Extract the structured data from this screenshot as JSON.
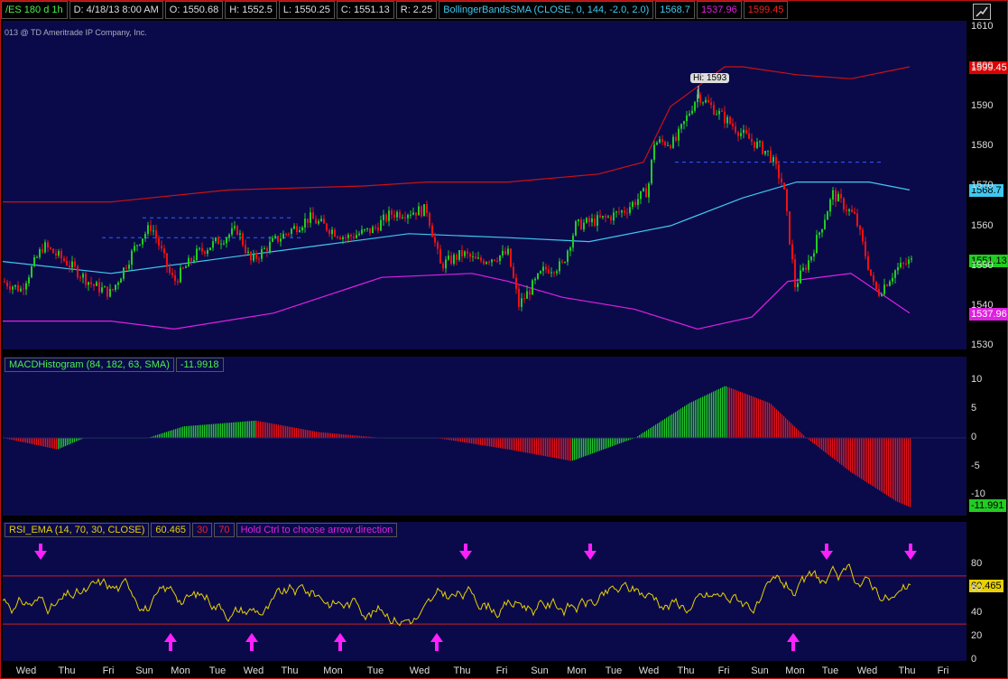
{
  "toolbar": {
    "symbol": "/ES 180 d 1h",
    "date": "D: 4/18/13 8:00 AM",
    "open": "O: 1550.68",
    "high": "H: 1552.5",
    "low": "L: 1550.25",
    "close": "C: 1551.13",
    "range": "R: 2.25",
    "study": "BollingerBandsSMA (CLOSE, 0, 144, -2.0, 2.0)",
    "mid_value": "1568.7",
    "lower_value": "1537.96",
    "upper_value": "1599.45"
  },
  "copyright": "013 @ TD Ameritrade IP Company, Inc.",
  "price_pane": {
    "hi_label": "Hi: 1593",
    "ticks": [
      "1610",
      "1600",
      "1590",
      "1580",
      "1570",
      "1560",
      "1550",
      "1540",
      "1530"
    ],
    "badges": {
      "upper": "1599.45",
      "mid": "1568.7",
      "last": "1551.13",
      "lower": "1537.96"
    }
  },
  "macd_pane": {
    "label": "MACDHistogram (84, 182, 63, SMA)",
    "value": "-11.9918",
    "ticks": [
      "10",
      "5",
      "0",
      "-5",
      "-10"
    ],
    "badge": "-11.991"
  },
  "rsi_pane": {
    "label": "RSI_EMA (14, 70, 30, CLOSE)",
    "value": "60.465",
    "ob": "30",
    "os": "70",
    "hint": "Hold Ctrl to choose arrow direction",
    "ticks": [
      "80",
      "60",
      "40",
      "20",
      "0"
    ],
    "badge": "60.465"
  },
  "days": [
    "Wed",
    "Thu",
    "Fri",
    "Sun",
    "Mon",
    "Tue",
    "Wed",
    "Thu",
    "Mon",
    "Tue",
    "Wed",
    "Thu",
    "Fri",
    "Sun",
    "Mon",
    "Tue",
    "Wed",
    "Thu",
    "Fri",
    "Sun",
    "Mon",
    "Tue",
    "Wed",
    "Thu",
    "Fri"
  ],
  "colors": {
    "up": "#22cc22",
    "down": "#ee1111",
    "mid": "#40c8f0",
    "lower": "#e020e0",
    "upper": "#cc1111",
    "rsi": "#e8d000",
    "arrow": "#ff20ff"
  }
}
